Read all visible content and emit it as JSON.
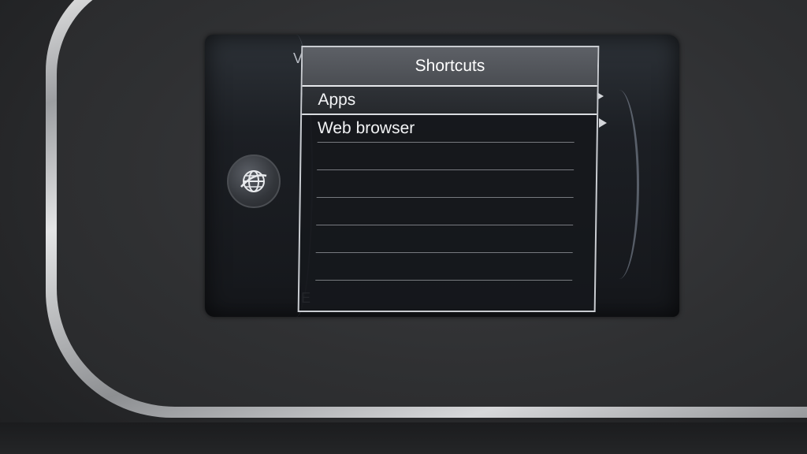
{
  "popup": {
    "title": "Shortcuts",
    "items": [
      {
        "label": "Apps"
      },
      {
        "label": "Web browser"
      }
    ],
    "empty_rows": 6
  },
  "background": {
    "left_letters": [
      "V",
      "E"
    ],
    "icon": "globe-icon"
  },
  "colors": {
    "popup_header": "#4f5257",
    "popup_border": "#c9ccd1",
    "text": "#f2f3f5"
  }
}
